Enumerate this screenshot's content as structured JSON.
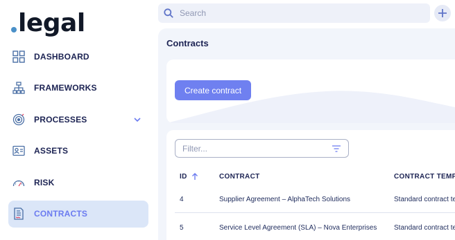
{
  "app": {
    "logo_text": "legal",
    "logo_dot_color": "#4a90c8"
  },
  "search": {
    "placeholder": "Search"
  },
  "sidebar": {
    "items": [
      {
        "label": "DASHBOARD",
        "icon": "dashboard-icon"
      },
      {
        "label": "FRAMEWORKS",
        "icon": "frameworks-icon"
      },
      {
        "label": "PROCESSES",
        "icon": "processes-icon",
        "expandable": true
      },
      {
        "label": "ASSETS",
        "icon": "assets-icon"
      },
      {
        "label": "RISK",
        "icon": "risk-gauge-icon"
      },
      {
        "label": "CONTRACTS",
        "icon": "contracts-icon",
        "active": true
      }
    ]
  },
  "main": {
    "title": "Contracts",
    "create_button": "Create contract",
    "filter_placeholder": "Filter...",
    "table": {
      "columns": [
        "ID",
        "CONTRACT",
        "CONTRACT TEMPLATE"
      ],
      "sort_column": "ID",
      "rows": [
        {
          "id": "4",
          "contract": "Supplier Agreement – AlphaTech Solutions",
          "template": "Standard contract template"
        },
        {
          "id": "5",
          "contract": "Service Level Agreement (SLA) – Nova Enterprises",
          "template": "Standard contract template"
        }
      ]
    }
  },
  "colors": {
    "accent": "#6f80f0",
    "active_bg": "#dbe6f8",
    "nav_text": "#1c2353"
  }
}
